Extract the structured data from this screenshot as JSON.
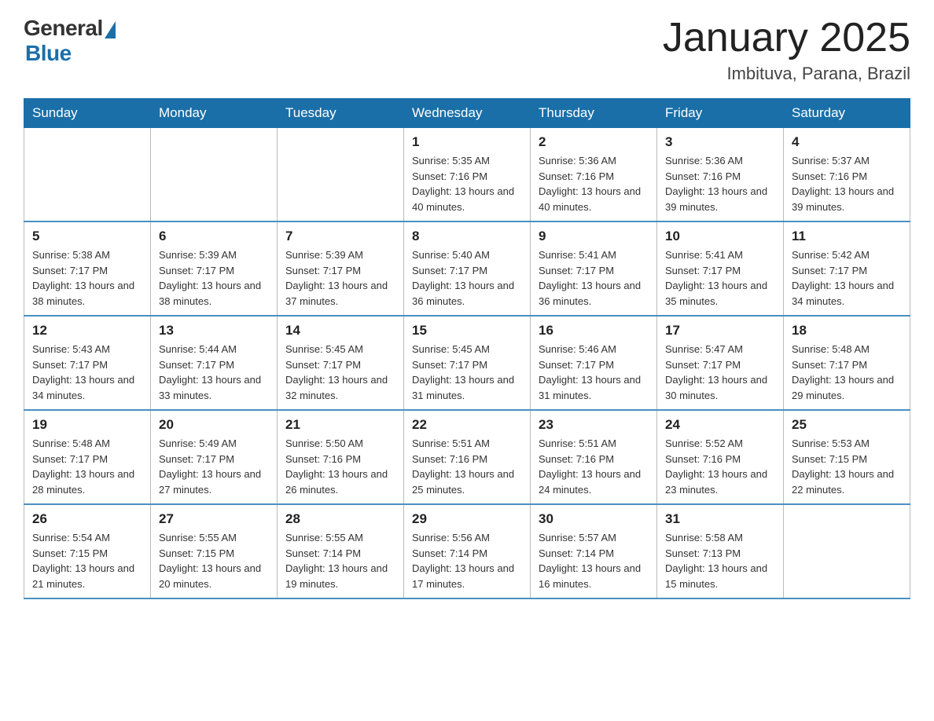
{
  "header": {
    "logo_general": "General",
    "logo_blue": "Blue",
    "month_title": "January 2025",
    "location": "Imbituva, Parana, Brazil"
  },
  "weekdays": [
    "Sunday",
    "Monday",
    "Tuesday",
    "Wednesday",
    "Thursday",
    "Friday",
    "Saturday"
  ],
  "weeks": [
    [
      {
        "day": "",
        "sunrise": "",
        "sunset": "",
        "daylight": ""
      },
      {
        "day": "",
        "sunrise": "",
        "sunset": "",
        "daylight": ""
      },
      {
        "day": "",
        "sunrise": "",
        "sunset": "",
        "daylight": ""
      },
      {
        "day": "1",
        "sunrise": "Sunrise: 5:35 AM",
        "sunset": "Sunset: 7:16 PM",
        "daylight": "Daylight: 13 hours and 40 minutes."
      },
      {
        "day": "2",
        "sunrise": "Sunrise: 5:36 AM",
        "sunset": "Sunset: 7:16 PM",
        "daylight": "Daylight: 13 hours and 40 minutes."
      },
      {
        "day": "3",
        "sunrise": "Sunrise: 5:36 AM",
        "sunset": "Sunset: 7:16 PM",
        "daylight": "Daylight: 13 hours and 39 minutes."
      },
      {
        "day": "4",
        "sunrise": "Sunrise: 5:37 AM",
        "sunset": "Sunset: 7:16 PM",
        "daylight": "Daylight: 13 hours and 39 minutes."
      }
    ],
    [
      {
        "day": "5",
        "sunrise": "Sunrise: 5:38 AM",
        "sunset": "Sunset: 7:17 PM",
        "daylight": "Daylight: 13 hours and 38 minutes."
      },
      {
        "day": "6",
        "sunrise": "Sunrise: 5:39 AM",
        "sunset": "Sunset: 7:17 PM",
        "daylight": "Daylight: 13 hours and 38 minutes."
      },
      {
        "day": "7",
        "sunrise": "Sunrise: 5:39 AM",
        "sunset": "Sunset: 7:17 PM",
        "daylight": "Daylight: 13 hours and 37 minutes."
      },
      {
        "day": "8",
        "sunrise": "Sunrise: 5:40 AM",
        "sunset": "Sunset: 7:17 PM",
        "daylight": "Daylight: 13 hours and 36 minutes."
      },
      {
        "day": "9",
        "sunrise": "Sunrise: 5:41 AM",
        "sunset": "Sunset: 7:17 PM",
        "daylight": "Daylight: 13 hours and 36 minutes."
      },
      {
        "day": "10",
        "sunrise": "Sunrise: 5:41 AM",
        "sunset": "Sunset: 7:17 PM",
        "daylight": "Daylight: 13 hours and 35 minutes."
      },
      {
        "day": "11",
        "sunrise": "Sunrise: 5:42 AM",
        "sunset": "Sunset: 7:17 PM",
        "daylight": "Daylight: 13 hours and 34 minutes."
      }
    ],
    [
      {
        "day": "12",
        "sunrise": "Sunrise: 5:43 AM",
        "sunset": "Sunset: 7:17 PM",
        "daylight": "Daylight: 13 hours and 34 minutes."
      },
      {
        "day": "13",
        "sunrise": "Sunrise: 5:44 AM",
        "sunset": "Sunset: 7:17 PM",
        "daylight": "Daylight: 13 hours and 33 minutes."
      },
      {
        "day": "14",
        "sunrise": "Sunrise: 5:45 AM",
        "sunset": "Sunset: 7:17 PM",
        "daylight": "Daylight: 13 hours and 32 minutes."
      },
      {
        "day": "15",
        "sunrise": "Sunrise: 5:45 AM",
        "sunset": "Sunset: 7:17 PM",
        "daylight": "Daylight: 13 hours and 31 minutes."
      },
      {
        "day": "16",
        "sunrise": "Sunrise: 5:46 AM",
        "sunset": "Sunset: 7:17 PM",
        "daylight": "Daylight: 13 hours and 31 minutes."
      },
      {
        "day": "17",
        "sunrise": "Sunrise: 5:47 AM",
        "sunset": "Sunset: 7:17 PM",
        "daylight": "Daylight: 13 hours and 30 minutes."
      },
      {
        "day": "18",
        "sunrise": "Sunrise: 5:48 AM",
        "sunset": "Sunset: 7:17 PM",
        "daylight": "Daylight: 13 hours and 29 minutes."
      }
    ],
    [
      {
        "day": "19",
        "sunrise": "Sunrise: 5:48 AM",
        "sunset": "Sunset: 7:17 PM",
        "daylight": "Daylight: 13 hours and 28 minutes."
      },
      {
        "day": "20",
        "sunrise": "Sunrise: 5:49 AM",
        "sunset": "Sunset: 7:17 PM",
        "daylight": "Daylight: 13 hours and 27 minutes."
      },
      {
        "day": "21",
        "sunrise": "Sunrise: 5:50 AM",
        "sunset": "Sunset: 7:16 PM",
        "daylight": "Daylight: 13 hours and 26 minutes."
      },
      {
        "day": "22",
        "sunrise": "Sunrise: 5:51 AM",
        "sunset": "Sunset: 7:16 PM",
        "daylight": "Daylight: 13 hours and 25 minutes."
      },
      {
        "day": "23",
        "sunrise": "Sunrise: 5:51 AM",
        "sunset": "Sunset: 7:16 PM",
        "daylight": "Daylight: 13 hours and 24 minutes."
      },
      {
        "day": "24",
        "sunrise": "Sunrise: 5:52 AM",
        "sunset": "Sunset: 7:16 PM",
        "daylight": "Daylight: 13 hours and 23 minutes."
      },
      {
        "day": "25",
        "sunrise": "Sunrise: 5:53 AM",
        "sunset": "Sunset: 7:15 PM",
        "daylight": "Daylight: 13 hours and 22 minutes."
      }
    ],
    [
      {
        "day": "26",
        "sunrise": "Sunrise: 5:54 AM",
        "sunset": "Sunset: 7:15 PM",
        "daylight": "Daylight: 13 hours and 21 minutes."
      },
      {
        "day": "27",
        "sunrise": "Sunrise: 5:55 AM",
        "sunset": "Sunset: 7:15 PM",
        "daylight": "Daylight: 13 hours and 20 minutes."
      },
      {
        "day": "28",
        "sunrise": "Sunrise: 5:55 AM",
        "sunset": "Sunset: 7:14 PM",
        "daylight": "Daylight: 13 hours and 19 minutes."
      },
      {
        "day": "29",
        "sunrise": "Sunrise: 5:56 AM",
        "sunset": "Sunset: 7:14 PM",
        "daylight": "Daylight: 13 hours and 17 minutes."
      },
      {
        "day": "30",
        "sunrise": "Sunrise: 5:57 AM",
        "sunset": "Sunset: 7:14 PM",
        "daylight": "Daylight: 13 hours and 16 minutes."
      },
      {
        "day": "31",
        "sunrise": "Sunrise: 5:58 AM",
        "sunset": "Sunset: 7:13 PM",
        "daylight": "Daylight: 13 hours and 15 minutes."
      },
      {
        "day": "",
        "sunrise": "",
        "sunset": "",
        "daylight": ""
      }
    ]
  ]
}
